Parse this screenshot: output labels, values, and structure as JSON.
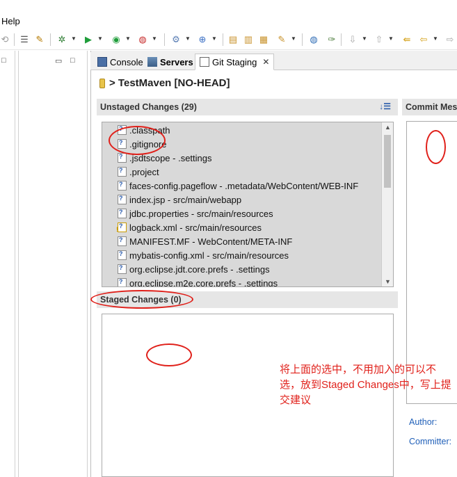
{
  "menu": {
    "help": "Help"
  },
  "tabs": [
    {
      "label": "Console"
    },
    {
      "label": "Servers"
    },
    {
      "label": "Git Staging"
    }
  ],
  "repository": {
    "title": "> TestMaven [NO-HEAD]"
  },
  "unstaged": {
    "header": "Unstaged Changes (29)",
    "files": [
      {
        "name": ".classpath",
        "status": "untracked"
      },
      {
        "name": ".gitignore",
        "status": "untracked"
      },
      {
        "name": ".jsdtscope - .settings",
        "status": "untracked"
      },
      {
        "name": ".project",
        "status": "untracked"
      },
      {
        "name": "faces-config.pageflow - .metadata/WebContent/WEB-INF",
        "status": "untracked"
      },
      {
        "name": "index.jsp - src/main/webapp",
        "status": "untracked"
      },
      {
        "name": "jdbc.properties - src/main/resources",
        "status": "untracked"
      },
      {
        "name": "logback.xml - src/main/resources",
        "status": "warning"
      },
      {
        "name": "MANIFEST.MF - WebContent/META-INF",
        "status": "untracked"
      },
      {
        "name": "mybatis-config.xml - src/main/resources",
        "status": "untracked"
      },
      {
        "name": "org.eclipse.jdt.core.prefs - .settings",
        "status": "untracked"
      },
      {
        "name": "org.eclipse.m2e.core.prefs - .settings",
        "status": "untracked"
      }
    ]
  },
  "staged": {
    "header": "Staged Changes (0)"
  },
  "commit": {
    "header": "Commit Mes",
    "author_label": "Author:",
    "committer_label": "Committer:"
  },
  "annotation": {
    "text": "将上面的选中，不用加入的可以不选，放到Staged Changes中，写上提交建议",
    "color": "#e0201a"
  }
}
